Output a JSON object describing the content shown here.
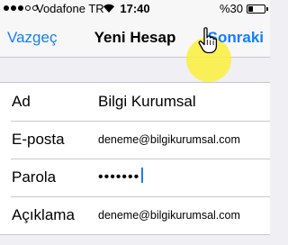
{
  "status_bar": {
    "carrier": "Vodafone TR",
    "time": "17:40",
    "battery_label": "%30",
    "battery_level_percent": 30,
    "signal_bars_filled": 3,
    "signal_bars_total": 5,
    "wifi_icon": "wifi-icon"
  },
  "nav": {
    "cancel_label": "Vazgeç",
    "title": "Yeni Hesap",
    "next_label": "Sonraki"
  },
  "form": {
    "rows": [
      {
        "label": "Ad",
        "value": "Bilgi Kurumsal"
      },
      {
        "label": "E-posta",
        "value": "deneme@bilgikurumsal.com"
      },
      {
        "label": "Parola",
        "value": "•••••••"
      },
      {
        "label": "Açıklama",
        "value": "deneme@bilgikurumsal.com"
      }
    ]
  },
  "colors": {
    "accent": "#147efb",
    "background": "#efeff4",
    "highlight": "#faf03c"
  },
  "icons": {
    "pointer": "hand-pointer-icon"
  }
}
